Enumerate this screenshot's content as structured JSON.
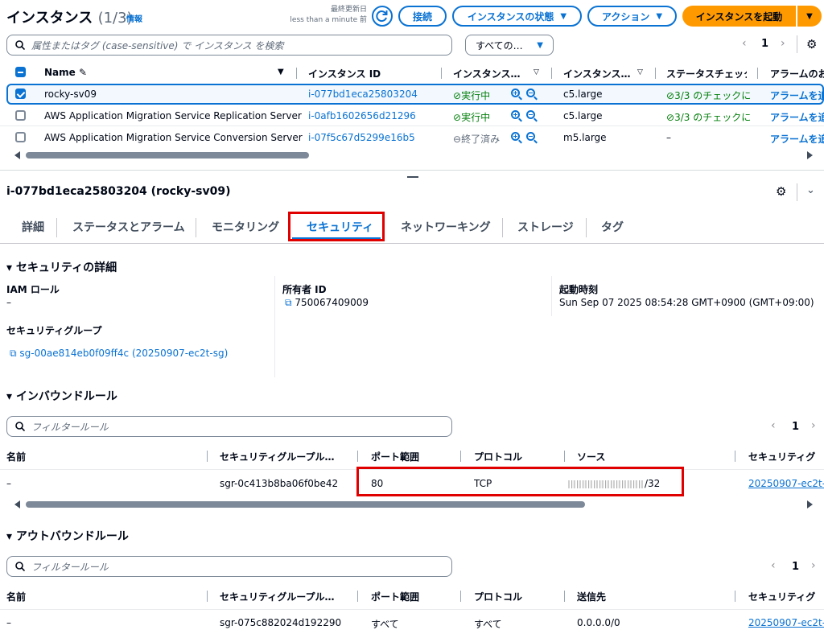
{
  "header": {
    "title": "インスタンス",
    "count": "(1/3)",
    "info": "情報",
    "last_updated_label": "最終更新日",
    "last_updated_value": "less than a minute 前",
    "connect": "接続",
    "instance_state": "インスタンスの状態",
    "actions": "アクション",
    "launch": "インスタンスを起動"
  },
  "search": {
    "placeholder": "属性またはタグ (case-sensitive) で インスタンス を検索",
    "filter_select": "すべての…",
    "page": "1"
  },
  "table": {
    "columns": [
      "Name",
      "インスタンス ID",
      "インスタンス…",
      "インスタンス…",
      "ステータスチェック",
      "アラームのお"
    ],
    "rows": [
      {
        "name": "rocky-sv09",
        "id": "i-077bd1eca25803204",
        "state": "実行中",
        "type": "c5.large",
        "check": "3/3 のチェックに",
        "alarm": "アラームを追",
        "selected": true
      },
      {
        "name": "AWS Application Migration Service Replication Server",
        "id": "i-0afb1602656d21296",
        "state": "実行中",
        "type": "c5.large",
        "check": "3/3 のチェックに",
        "alarm": "アラームを追",
        "selected": false
      },
      {
        "name": "AWS Application Migration Service Conversion Server",
        "id": "i-07f5c67d5299e16b5",
        "state": "終了済み",
        "type": "m5.large",
        "check": "–",
        "alarm": "アラームを追",
        "selected": false
      }
    ]
  },
  "detail": {
    "title": "i-077bd1eca25803204 (rocky-sv09)",
    "tabs": [
      "詳細",
      "ステータスとアラーム",
      "モニタリング",
      "セキュリティ",
      "ネットワーキング",
      "ストレージ",
      "タグ"
    ],
    "security_details_heading": "セキュリティの詳細",
    "iam_role_label": "IAM ロール",
    "iam_role_value": "–",
    "owner_label": "所有者 ID",
    "owner_value": "750067409009",
    "launch_time_label": "起動時刻",
    "launch_time_value": "Sun Sep 07 2025 08:54:28 GMT+0900 (GMT+09:00)",
    "sg_label": "セキュリティグループ",
    "sg_value": "sg-00ae814eb0f09ff4c (20250907-ec2t-sg)"
  },
  "inbound": {
    "heading": "インバウンドルール",
    "filter_placeholder": "フィルタールール",
    "page": "1",
    "columns": [
      "名前",
      "セキュリティグループル…",
      "ポート範囲",
      "プロトコル",
      "ソース",
      "セキュリティグ"
    ],
    "row": {
      "name": "–",
      "rule_id": "sgr-0c413b8ba06f0be42",
      "port": "80",
      "protocol": "TCP",
      "source_suffix": "/32",
      "sg": "20250907-ec2t-"
    }
  },
  "outbound": {
    "heading": "アウトバウンドルール",
    "filter_placeholder": "フィルタールール",
    "page": "1",
    "columns": [
      "名前",
      "セキュリティグループル…",
      "ポート範囲",
      "プロトコル",
      "送信先",
      "セキュリティグ"
    ],
    "row": {
      "name": "–",
      "rule_id": "sgr-075c882024d192290",
      "port": "すべて",
      "protocol": "すべて",
      "destination": "0.0.0.0/0",
      "sg": "20250907-ec2t-"
    }
  },
  "colors": {
    "accent": "#0972d3",
    "launch": "#ff9900",
    "highlight": "#e00000",
    "running": "#037f0c"
  }
}
